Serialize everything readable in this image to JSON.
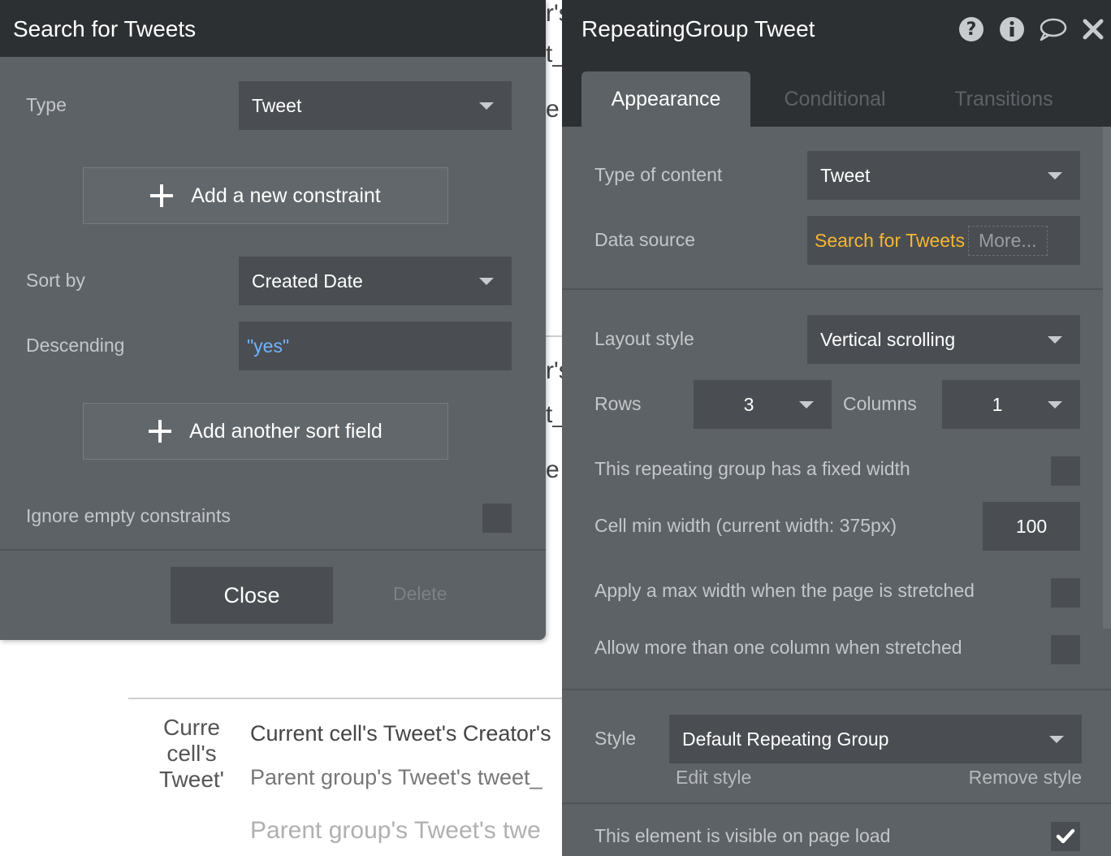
{
  "background": {
    "fragments": [
      "r's",
      "t_",
      "e",
      "r's",
      "t_",
      "e"
    ],
    "cell_image_alt": [
      "Curre",
      "cell's",
      "Tweet'"
    ],
    "cell_rows": [
      "Current cell's Tweet's Creator's",
      "Parent group's Tweet's tweet_",
      "Parent group's Tweet's twe"
    ]
  },
  "search_panel": {
    "title": "Search for Tweets",
    "type_label": "Type",
    "type_value": "Tweet",
    "add_constraint": "Add a new constraint",
    "sort_by_label": "Sort by",
    "sort_by_value": "Created Date",
    "descending_label": "Descending",
    "descending_value": "\"yes\"",
    "add_sort": "Add another sort field",
    "ignore_empty_label": "Ignore empty constraints",
    "close": "Close",
    "delete": "Delete"
  },
  "prop_panel": {
    "title": "RepeatingGroup Tweet",
    "tabs": [
      "Appearance",
      "Conditional",
      "Transitions"
    ],
    "type_of_content_label": "Type of content",
    "type_of_content_value": "Tweet",
    "data_source_label": "Data source",
    "data_source_value": "Search for Tweets",
    "data_source_more": "More...",
    "layout_style_label": "Layout style",
    "layout_style_value": "Vertical scrolling",
    "rows_label": "Rows",
    "rows_value": "3",
    "columns_label": "Columns",
    "columns_value": "1",
    "fixed_width_label": "This repeating group has a fixed width",
    "cell_min_width_label": "Cell min width (current width: 375px)",
    "cell_min_width_value": "100",
    "max_width_label": "Apply a max width when the page is stretched",
    "multi_column_label": "Allow more than one column when stretched",
    "style_label": "Style",
    "style_value": "Default Repeating Group",
    "edit_style": "Edit style",
    "remove_style": "Remove style",
    "visible_label": "This element is visible on page load"
  },
  "colors": {
    "panel_bg": "#5d6266",
    "header_bg": "#2d3033",
    "field_bg": "#4a4e52",
    "data_source_accent": "#f5b731",
    "dynamic_value": "#6fb3ff"
  },
  "icons": [
    "help-icon",
    "info-icon",
    "comment-icon",
    "close-icon",
    "plus-icon",
    "dropdown-caret-icon",
    "checkmark-icon"
  ]
}
